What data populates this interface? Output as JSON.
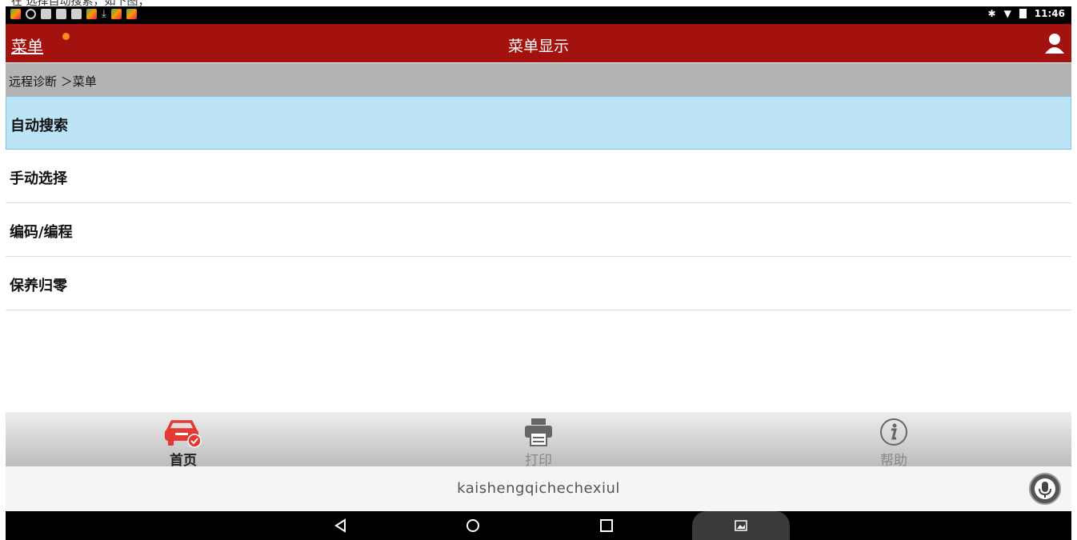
{
  "top_artifact": "在  选择自动搜索，如下图；",
  "status_bar": {
    "time": "11:46"
  },
  "app_bar": {
    "menu_label": "菜单",
    "title": "菜单显示"
  },
  "breadcrumb": "远程诊断 ＞菜单",
  "menu_items": [
    {
      "label": "自动搜索",
      "selected": true
    },
    {
      "label": "手动选择"
    },
    {
      "label": "编码/编程"
    },
    {
      "label": "保养归零"
    }
  ],
  "tabs": [
    {
      "label": "首页",
      "icon": "car-check-icon",
      "active": true
    },
    {
      "label": "打印",
      "icon": "printer-icon"
    },
    {
      "label": "帮助",
      "icon": "info-icon"
    }
  ],
  "input_bar": {
    "text": "kaishengqichechexiul"
  },
  "colors": {
    "app_bar": "#a3120f",
    "selected_row": "#bde4f6",
    "tab_active_icon": "#e53935"
  }
}
